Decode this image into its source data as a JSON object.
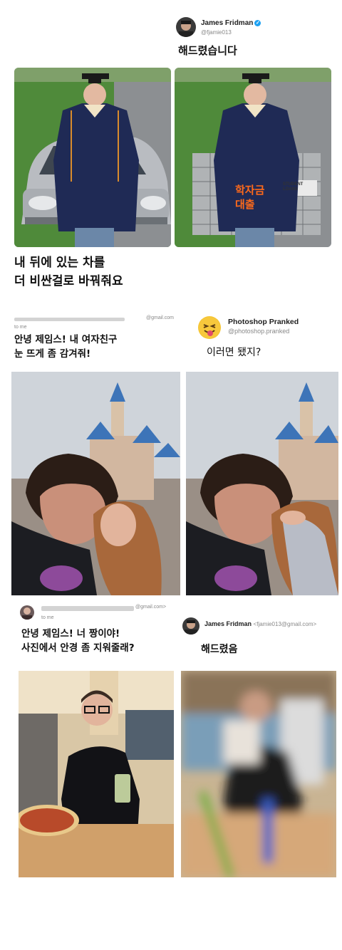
{
  "panel1": {
    "author_name": "James Fridman",
    "author_handle": "@fjamie013",
    "reply_text": "해드렸습니다",
    "request_lines": [
      "내 뒤에 있는 차를",
      "더 비싼걸로 바꿔줘요"
    ],
    "overlay_label_lines": [
      "학자금",
      "대출"
    ],
    "box_label_lines": [
      "STUDENT",
      "LOANS"
    ]
  },
  "panel2": {
    "sender_email_suffix": "@gmail.com",
    "to_me": "to me",
    "request_lines": [
      "안녕 제임스! 내 여자친구",
      "눈 뜨게 좀 감겨줘!"
    ],
    "responder_name": "Photoshop Pranked",
    "responder_handle": "@photoshop.pranked",
    "reply_text": "이러면 됐지?"
  },
  "panel3": {
    "sender_email_suffix": "@gmail.com>",
    "to_me": "to me",
    "request_lines": [
      "안녕 제임스! 너 짱이야!",
      "사진에서 안경 좀 지워줄래?"
    ],
    "responder_name": "James Fridman",
    "responder_email": "<fjamie013@gmail.com>",
    "reply_text": "해드렸음"
  },
  "colors": {
    "gown": "#1f2a55",
    "car": "#b9bcc1",
    "grass": "#4f8a3a",
    "overlay_text": "#ff6a1a",
    "sky": "#cfd4da",
    "castle_roof": "#3d74b8"
  }
}
